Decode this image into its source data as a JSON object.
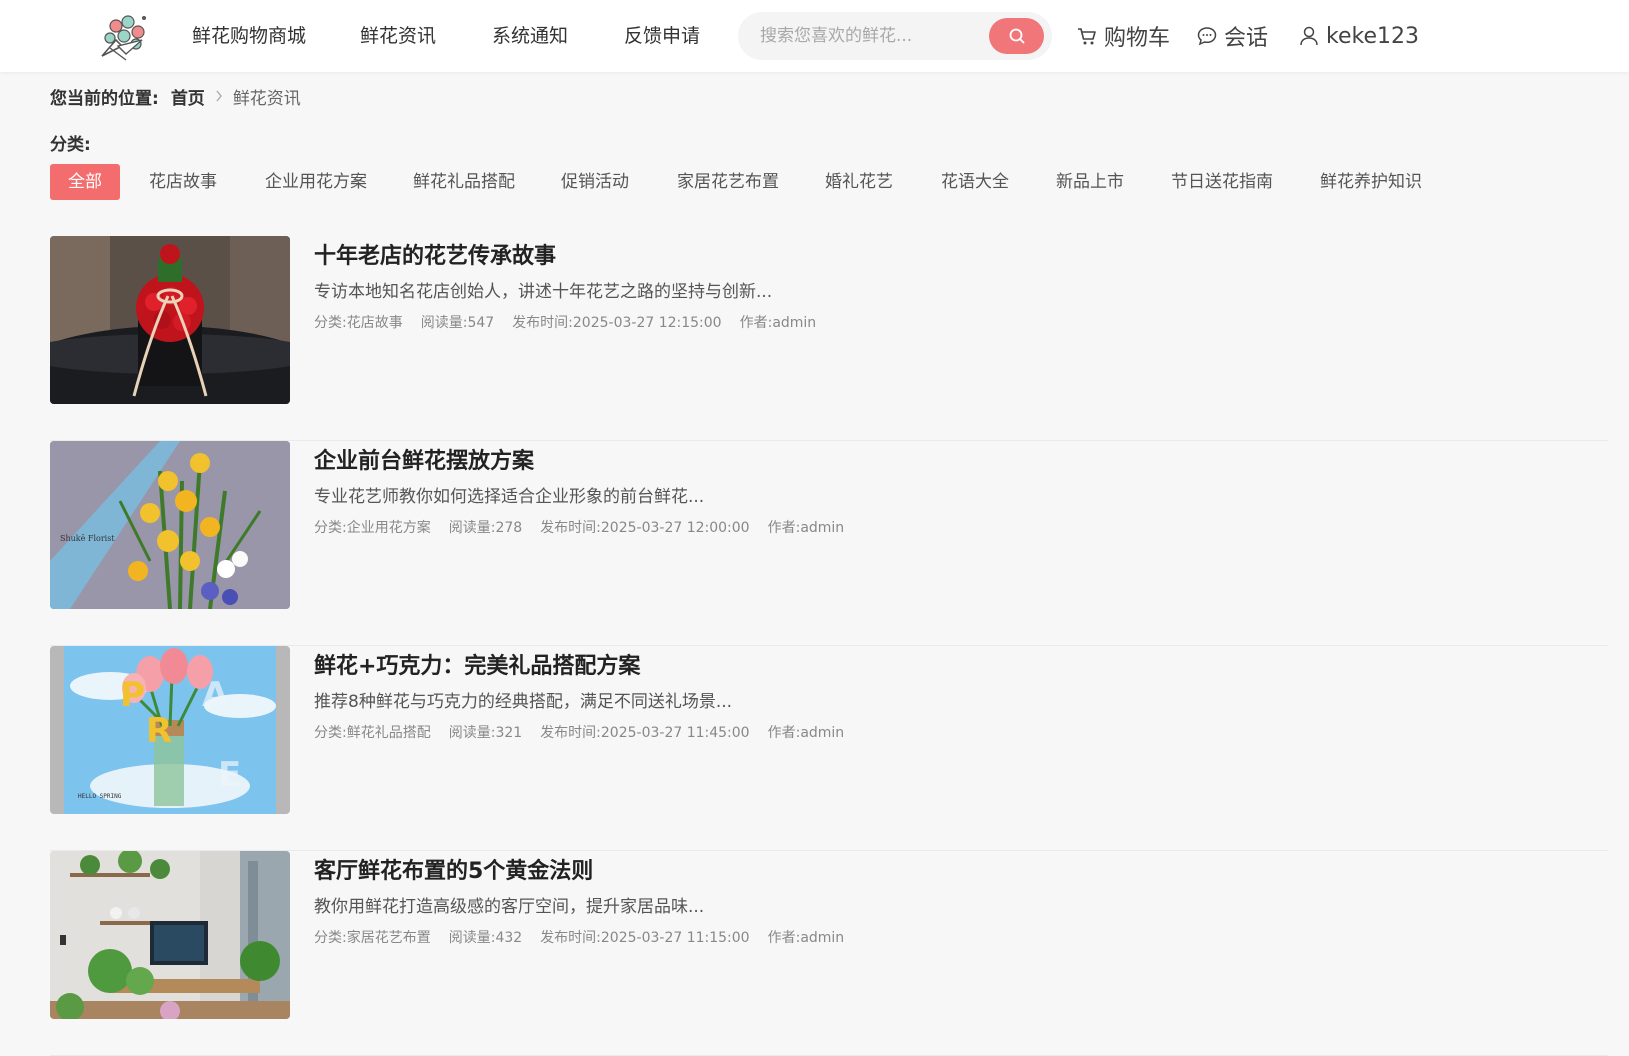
{
  "nav": {
    "items": [
      "鲜花购物商城",
      "鲜花资讯",
      "系统通知",
      "反馈申请"
    ],
    "search_placeholder": "搜索您喜欢的鲜花...",
    "cart_label": "购物车",
    "chat_label": "会话",
    "username": "keke123"
  },
  "breadcrumb": {
    "label": "您当前的位置:",
    "home": "首页",
    "current": "鲜花资讯"
  },
  "category": {
    "label": "分类:",
    "items": [
      "全部",
      "花店故事",
      "企业用花方案",
      "鲜花礼品搭配",
      "促销活动",
      "家居花艺布置",
      "婚礼花艺",
      "花语大全",
      "新品上市",
      "节日送花指南",
      "鲜花养护知识"
    ],
    "active": "全部"
  },
  "meta_labels": {
    "category": "分类:",
    "views": "阅读量:",
    "published": "发布时间:",
    "author": "作者:"
  },
  "articles": [
    {
      "title": "十年老店的花艺传承故事",
      "summary": "专访本地知名花店创始人，讲述十年花艺之路的坚持与创新...",
      "category": "花店故事",
      "views": "547",
      "published": "2025-03-27 12:15:00",
      "author": "admin"
    },
    {
      "title": "企业前台鲜花摆放方案",
      "summary": "专业花艺师教你如何选择适合企业形象的前台鲜花...",
      "category": "企业用花方案",
      "views": "278",
      "published": "2025-03-27 12:00:00",
      "author": "admin",
      "image_caption": "Shukē Florist"
    },
    {
      "title": "鲜花+巧克力：完美礼品搭配方案",
      "summary": "推荐8种鲜花与巧克力的经典搭配，满足不同送礼场景...",
      "category": "鲜花礼品搭配",
      "views": "321",
      "published": "2025-03-27 11:45:00",
      "author": "admin",
      "image_caption": "HELLO SPRING"
    },
    {
      "title": "客厅鲜花布置的5个黄金法则",
      "summary": "教你用鲜花打造高级感的客厅空间，提升家居品味...",
      "category": "家居花艺布置",
      "views": "432",
      "published": "2025-03-27 11:15:00",
      "author": "admin"
    }
  ],
  "colors": {
    "accent": "#f46d6e",
    "search_button": "#f0767a",
    "background": "#f7f7f8"
  }
}
